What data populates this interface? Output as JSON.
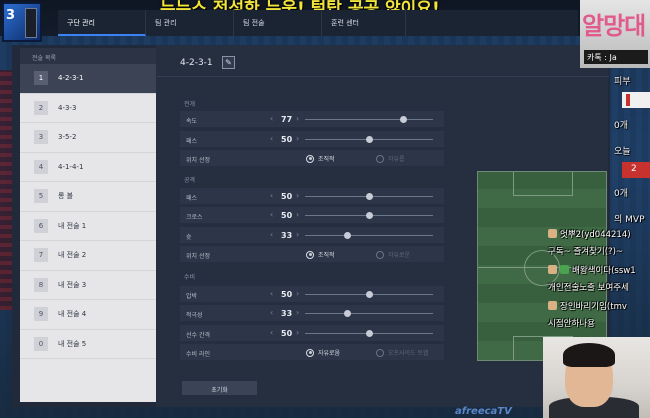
{
  "banner": {
    "title": "뉴뉴스 전성한 누욱! 털탑 공공 않이요!",
    "pc_number": "3"
  },
  "topnav": {
    "tabs": [
      "구단 관리",
      "팀 관리",
      "팀 전술",
      "훈련 센터"
    ]
  },
  "sidebar": {
    "header": "전술 목록",
    "items": [
      {
        "index": "1",
        "label": "4-2-3-1",
        "active": true
      },
      {
        "index": "2",
        "label": "4-3-3"
      },
      {
        "index": "3",
        "label": "3-5-2"
      },
      {
        "index": "4",
        "label": "4-1-4-1"
      },
      {
        "index": "5",
        "label": "롱 볼"
      },
      {
        "index": "6",
        "label": "내 전술 1"
      },
      {
        "index": "7",
        "label": "내 전술 2"
      },
      {
        "index": "8",
        "label": "내 전술 3"
      },
      {
        "index": "9",
        "label": "내 전술 4"
      },
      {
        "index": "0",
        "label": "내 전술 5"
      }
    ]
  },
  "formation": {
    "title": "4-2-3-1"
  },
  "sections": {
    "build": {
      "label": "전개",
      "speed": {
        "label": "속도",
        "value": "77",
        "level": 0.77
      },
      "pass": {
        "label": "패스",
        "value": "50",
        "level": 0.5
      },
      "positioning": {
        "label": "위치 선정",
        "opt1": "조직적",
        "opt2": "자유롭",
        "selected": "opt1"
      }
    },
    "attack": {
      "label": "공격",
      "pass": {
        "label": "패스",
        "value": "50",
        "level": 0.5
      },
      "cross": {
        "label": "크로스",
        "value": "50",
        "level": 0.5
      },
      "shot": {
        "label": "슛",
        "value": "33",
        "level": 0.33
      },
      "positioning": {
        "label": "위치 선정",
        "opt1": "조직적",
        "opt2": "자유로운",
        "selected": "opt1"
      }
    },
    "defense": {
      "label": "수비",
      "pressure": {
        "label": "압박",
        "value": "50",
        "level": 0.5
      },
      "aggression": {
        "label": "적극성",
        "value": "33",
        "level": 0.33
      },
      "width": {
        "label": "선수 간격",
        "value": "50",
        "level": 0.5
      },
      "line": {
        "label": "수비 라인",
        "opt1": "자유로움",
        "opt2": "오프사이드 트랩",
        "selected": "opt1"
      }
    }
  },
  "reset_label": "초기화",
  "overlay": {
    "logo_text": "알망대",
    "logo_sub": "카톡 : Ja",
    "stat1_label": "피부",
    "stat1_count": "0개",
    "stat2_label": "오늘",
    "stat2_value": "2",
    "stat2_count": "0개",
    "mvp_label": "의 MVP",
    "chat": [
      "엇뿌2(yd044214)",
      "구독~ 즐겨찾기(?)~",
      "배왕색이다(ssw1",
      "개인전술노출 보여주세",
      "장인바리기임(tmv",
      "시점안하나용"
    ],
    "bottom_logo": "afreecaTV"
  }
}
